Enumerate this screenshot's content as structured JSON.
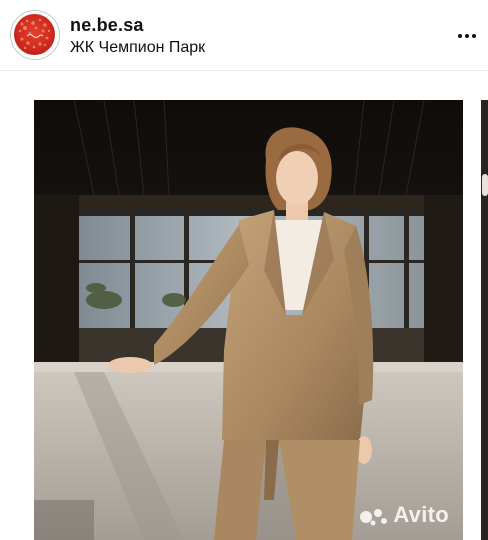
{
  "post": {
    "username": "ne.be.sa",
    "location": "ЖК Чемпион Парк",
    "more_icon": "more-dots-icon",
    "avatar_icon": "brand-logo-avatar"
  },
  "photo": {
    "watermark_text": "Avito",
    "watermark_icon": "avito-dots-icon"
  },
  "colors": {
    "avatar_red": "#cf2a1f",
    "suit_beige": "#b3926a",
    "sofa_grey": "#c3bdb4"
  }
}
